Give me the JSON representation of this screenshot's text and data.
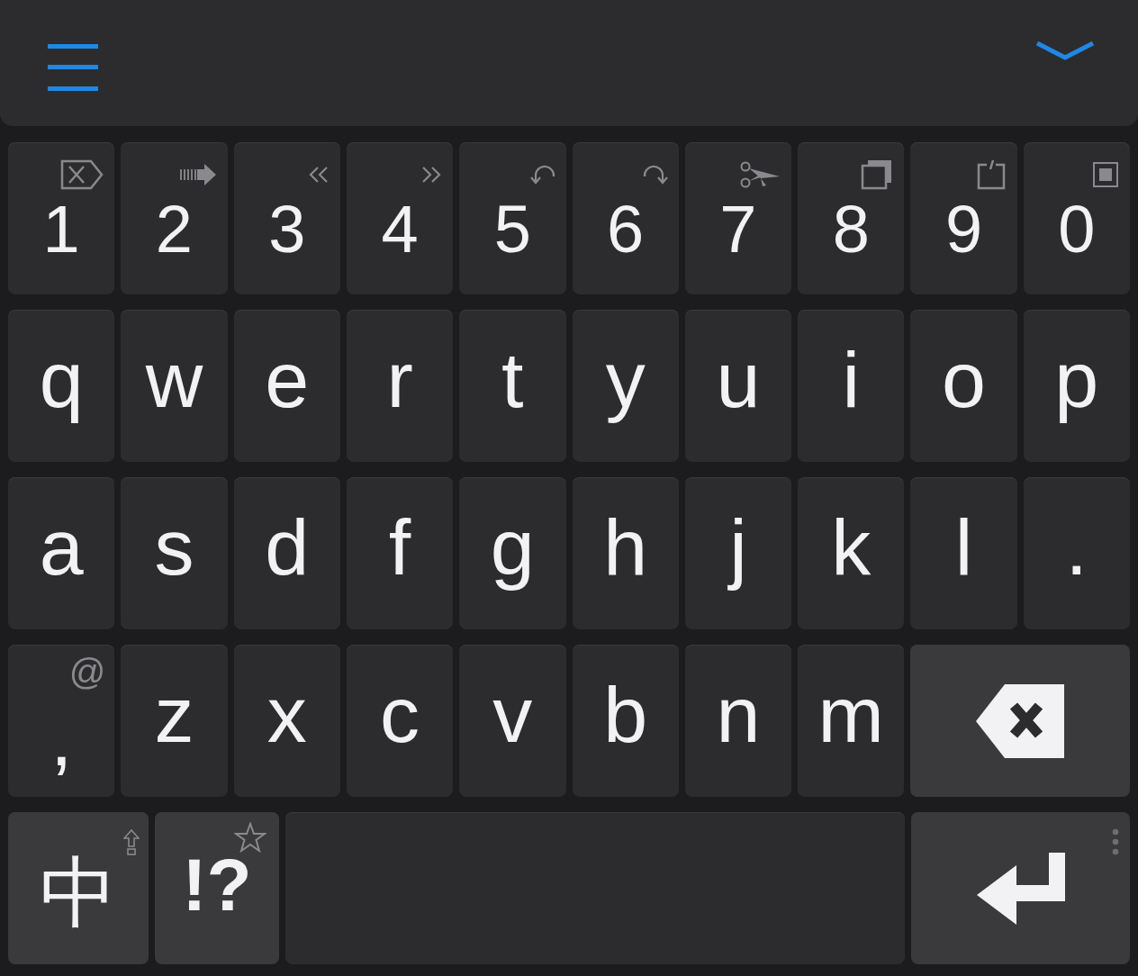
{
  "rows": [
    [
      {
        "kind": "char",
        "label": "1"
      },
      {
        "kind": "char",
        "label": "2"
      },
      {
        "kind": "char",
        "label": "3"
      },
      {
        "kind": "char",
        "label": "4"
      },
      {
        "kind": "char",
        "label": "5"
      },
      {
        "kind": "char",
        "label": "6"
      },
      {
        "kind": "char",
        "label": "7"
      },
      {
        "kind": "char",
        "label": "8"
      },
      {
        "kind": "char",
        "label": "9"
      },
      {
        "kind": "char",
        "label": "0"
      }
    ],
    [
      {
        "kind": "char",
        "label": "q"
      },
      {
        "kind": "char",
        "label": "w"
      },
      {
        "kind": "char",
        "label": "e"
      },
      {
        "kind": "char",
        "label": "r"
      },
      {
        "kind": "char",
        "label": "t"
      },
      {
        "kind": "char",
        "label": "y"
      },
      {
        "kind": "char",
        "label": "u"
      },
      {
        "kind": "char",
        "label": "i"
      },
      {
        "kind": "char",
        "label": "o"
      },
      {
        "kind": "char",
        "label": "p"
      }
    ],
    [
      {
        "kind": "char",
        "label": "a"
      },
      {
        "kind": "char",
        "label": "s"
      },
      {
        "kind": "char",
        "label": "d"
      },
      {
        "kind": "char",
        "label": "f"
      },
      {
        "kind": "char",
        "label": "g"
      },
      {
        "kind": "char",
        "label": "h"
      },
      {
        "kind": "char",
        "label": "j"
      },
      {
        "kind": "char",
        "label": "k"
      },
      {
        "kind": "char",
        "label": "l"
      },
      {
        "kind": "char",
        "label": "."
      }
    ],
    [
      {
        "kind": "char",
        "label": ",",
        "hint": "@"
      },
      {
        "kind": "char",
        "label": "z"
      },
      {
        "kind": "char",
        "label": "x"
      },
      {
        "kind": "char",
        "label": "c"
      },
      {
        "kind": "char",
        "label": "v"
      },
      {
        "kind": "char",
        "label": "b"
      },
      {
        "kind": "char",
        "label": "n"
      },
      {
        "kind": "char",
        "label": "m"
      },
      {
        "kind": "backspace"
      }
    ],
    [
      {
        "kind": "lang",
        "label": "中"
      },
      {
        "kind": "symbols",
        "label": "!?"
      },
      {
        "kind": "space"
      },
      {
        "kind": "enter"
      }
    ]
  ]
}
